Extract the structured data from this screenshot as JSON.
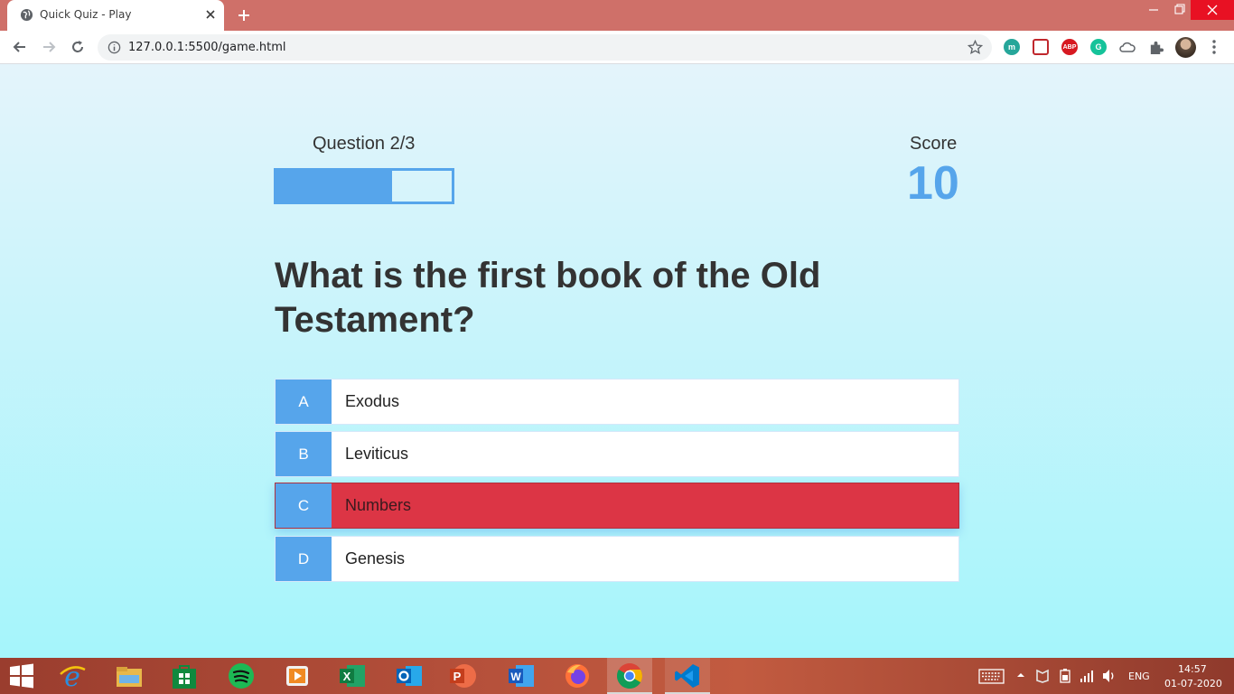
{
  "browser": {
    "tab_title": "Quick Quiz - Play",
    "url": "127.0.0.1:5500/game.html",
    "extensions": [
      {
        "icon": "m-extension-icon",
        "label": "m",
        "color": "#26a69a"
      },
      {
        "icon": "pocket-icon",
        "label": "",
        "color": "#ef4056"
      },
      {
        "icon": "adblock-plus-icon",
        "label": "ABP",
        "color": "#d71921"
      },
      {
        "icon": "grammarly-icon",
        "label": "G",
        "color": "#15c39a"
      }
    ]
  },
  "hud": {
    "question_label": "Question 2/3",
    "progress_fraction": 0.66,
    "score_label": "Score",
    "score_value": "10"
  },
  "question": "What is the first book of the Old Testament?",
  "choices": [
    {
      "prefix": "A",
      "text": "Exodus",
      "state": "default"
    },
    {
      "prefix": "B",
      "text": "Leviticus",
      "state": "default"
    },
    {
      "prefix": "C",
      "text": "Numbers",
      "state": "incorrect"
    },
    {
      "prefix": "D",
      "text": "Genesis",
      "state": "default"
    }
  ],
  "colors": {
    "accent": "#56a5eb",
    "incorrect": "#dc3545"
  },
  "taskbar": {
    "language": "ENG",
    "time": "14:57",
    "date": "01-07-2020",
    "apps": [
      "start-icon",
      "internet-explorer-icon",
      "file-explorer-icon",
      "store-icon",
      "spotify-icon",
      "media-player-icon",
      "excel-icon",
      "outlook-icon",
      "powerpoint-icon",
      "word-icon",
      "firefox-icon",
      "chrome-icon",
      "vscode-icon"
    ]
  }
}
